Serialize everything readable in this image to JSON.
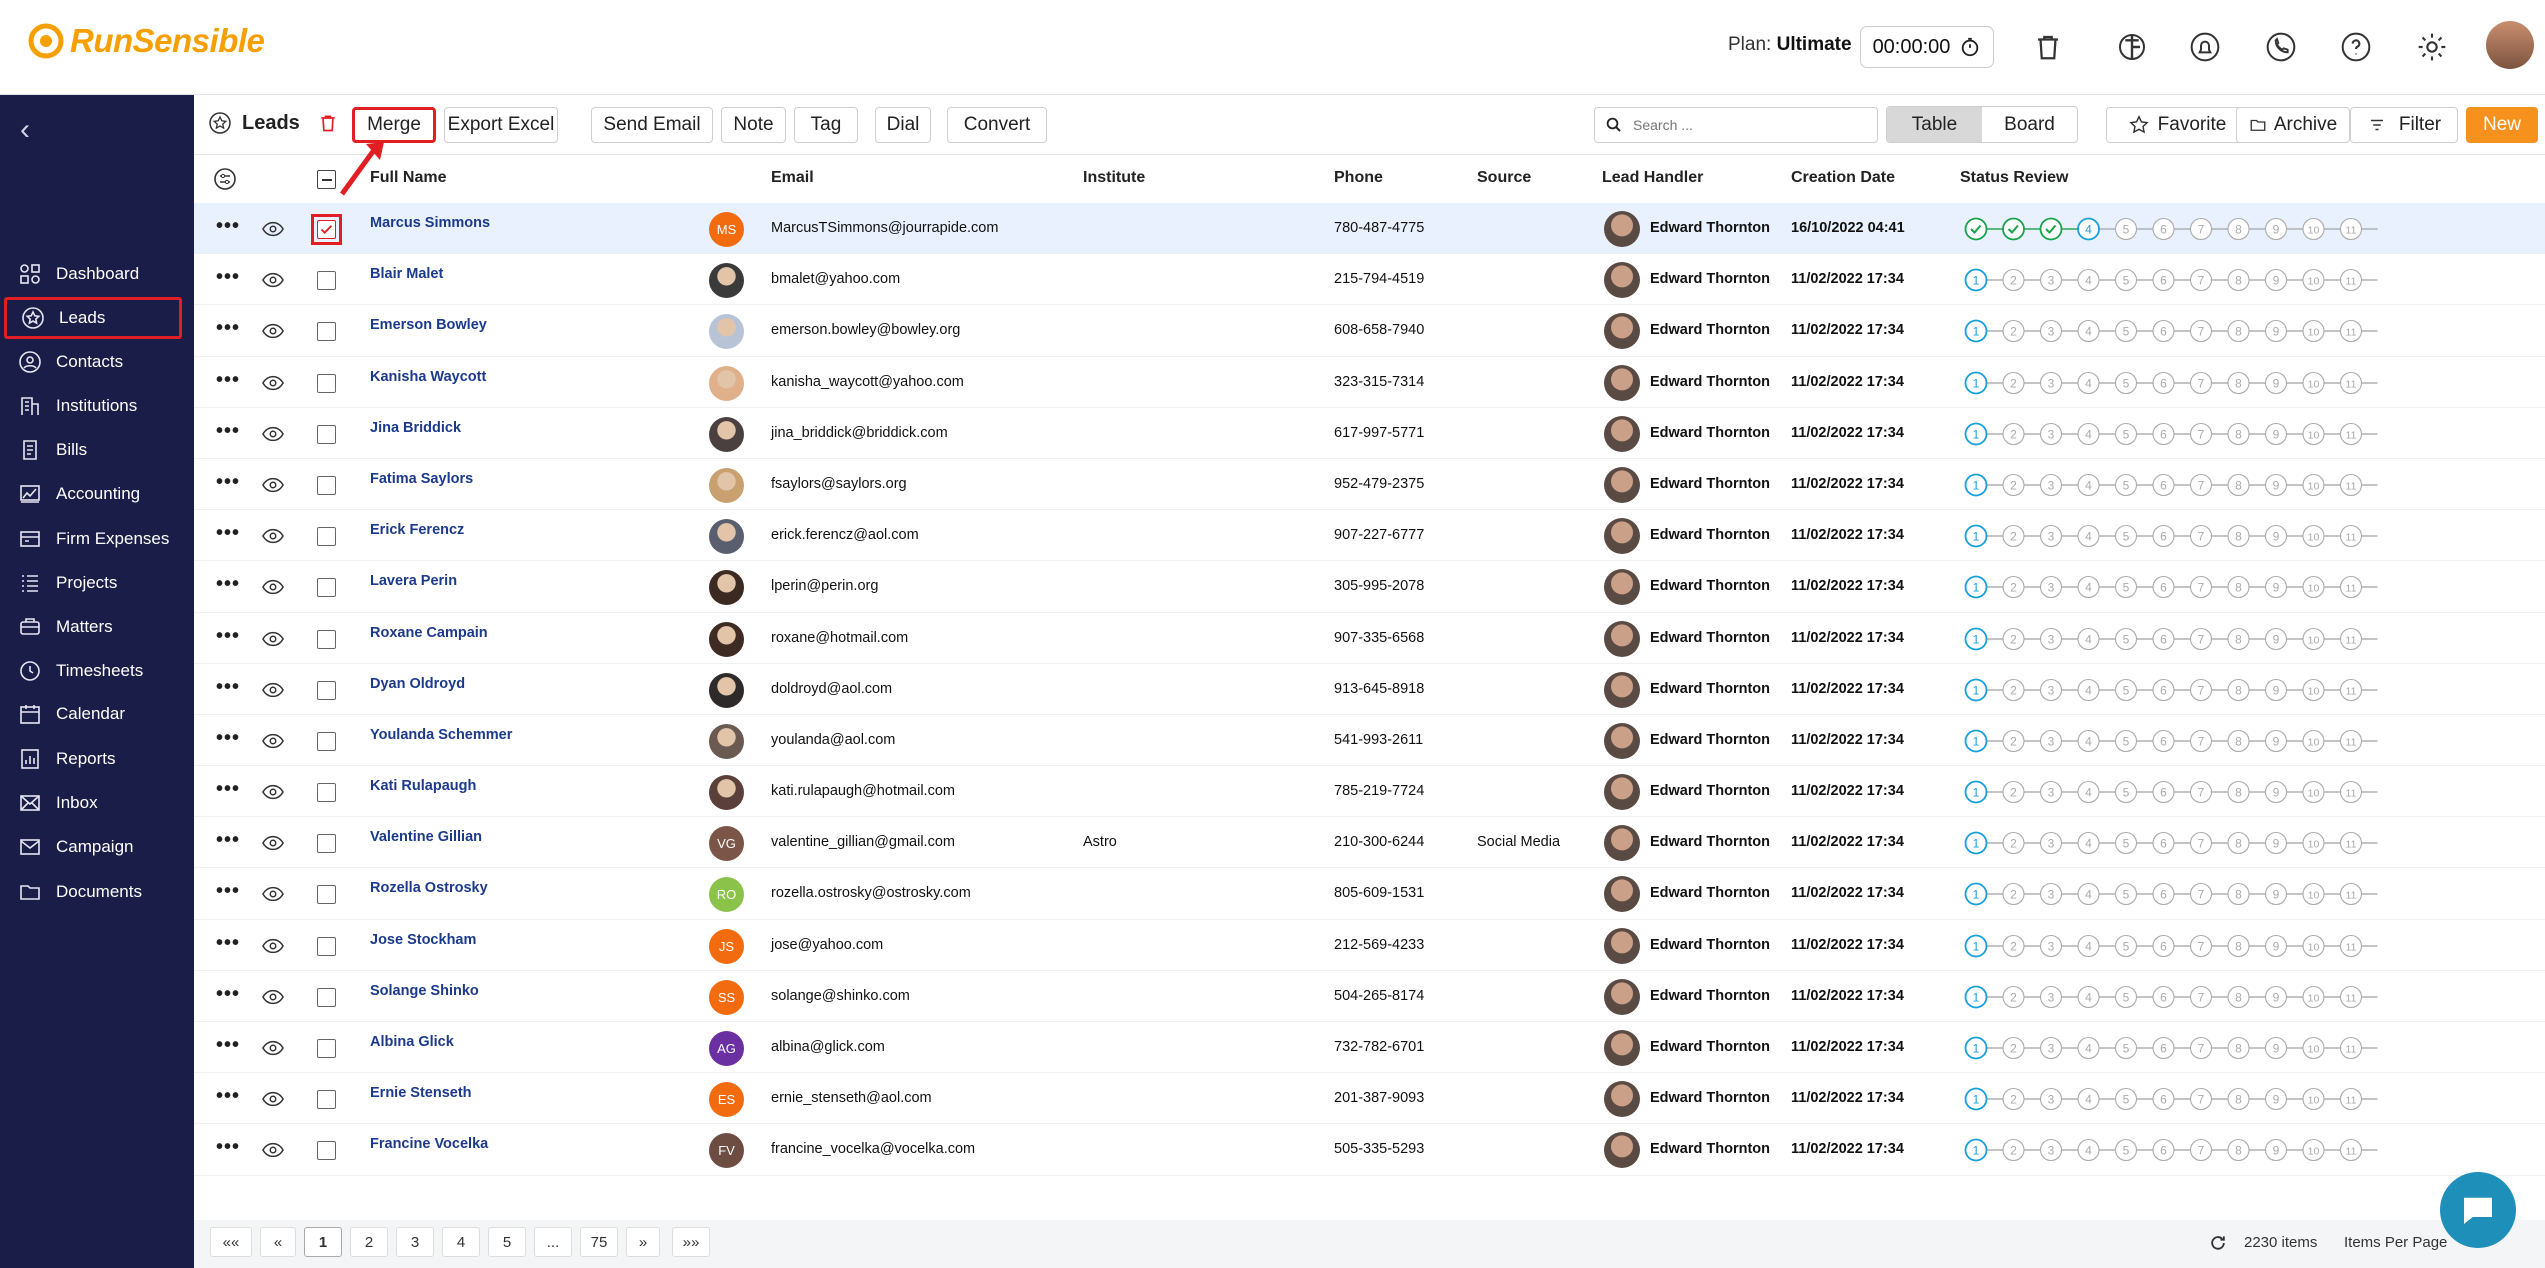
{
  "app": {
    "name": "RunSensible"
  },
  "header": {
    "plan_label": "Plan:",
    "plan_value": "Ultimate",
    "timer": "00:00:00"
  },
  "sidebar": {
    "items": [
      {
        "label": "Dashboard",
        "icon": "dashboard-icon"
      },
      {
        "label": "Leads",
        "icon": "leads-star-icon",
        "selected": true
      },
      {
        "label": "Contacts",
        "icon": "contacts-icon"
      },
      {
        "label": "Institutions",
        "icon": "institutions-icon"
      },
      {
        "label": "Bills",
        "icon": "bills-icon"
      },
      {
        "label": "Accounting",
        "icon": "accounting-icon"
      },
      {
        "label": "Firm Expenses",
        "icon": "firm-expenses-icon"
      },
      {
        "label": "Projects",
        "icon": "projects-icon"
      },
      {
        "label": "Matters",
        "icon": "matters-icon"
      },
      {
        "label": "Timesheets",
        "icon": "timesheets-icon"
      },
      {
        "label": "Calendar",
        "icon": "calendar-icon"
      },
      {
        "label": "Reports",
        "icon": "reports-icon"
      },
      {
        "label": "Inbox",
        "icon": "inbox-icon"
      },
      {
        "label": "Campaign",
        "icon": "campaign-icon"
      },
      {
        "label": "Documents",
        "icon": "documents-icon"
      }
    ]
  },
  "toolbar": {
    "title": "Leads",
    "actions": [
      "Merge",
      "Export Excel",
      "Send Email",
      "Note",
      "Tag",
      "Dial",
      "Convert"
    ],
    "search_placeholder": "Search ...",
    "views": [
      "Table",
      "Board"
    ],
    "active_view": "Table",
    "favorite": "Favorite",
    "archive": "Archive",
    "filter": "Filter",
    "new": "New"
  },
  "table": {
    "columns": {
      "full_name": "Full Name",
      "email": "Email",
      "institute": "Institute",
      "phone": "Phone",
      "source": "Source",
      "lead_handler": "Lead Handler",
      "creation_date": "Creation Date",
      "status_review": "Status Review"
    },
    "status_steps": [
      "1",
      "2",
      "3",
      "4",
      "5",
      "6",
      "7",
      "8",
      "9",
      "10",
      "11"
    ],
    "rows": [
      {
        "name": "Marcus Simmons",
        "initials": "MS",
        "avatar_color": "#f26b0f",
        "email": "MarcusTSimmons@jourrapide.com",
        "institute": "",
        "phone": "780-487-4775",
        "source": "",
        "handler": "Edward Thornton",
        "date": "16/10/2022 04:41",
        "checked": true,
        "status_done": 3
      },
      {
        "name": "Blair Malet",
        "initials": "",
        "avatar_color": "#3a3a3a",
        "email": "bmalet@yahoo.com",
        "institute": "",
        "phone": "215-794-4519",
        "source": "",
        "handler": "Edward Thornton",
        "date": "11/02/2022 17:34",
        "checked": false,
        "status_done": 0
      },
      {
        "name": "Emerson Bowley",
        "initials": "",
        "avatar_color": "#b8c4d6",
        "email": "emerson.bowley@bowley.org",
        "institute": "",
        "phone": "608-658-7940",
        "source": "",
        "handler": "Edward Thornton",
        "date": "11/02/2022 17:34",
        "checked": false,
        "status_done": 0
      },
      {
        "name": "Kanisha Waycott",
        "initials": "",
        "avatar_color": "#e0b08a",
        "email": "kanisha_waycott@yahoo.com",
        "institute": "",
        "phone": "323-315-7314",
        "source": "",
        "handler": "Edward Thornton",
        "date": "11/02/2022 17:34",
        "checked": false,
        "status_done": 0
      },
      {
        "name": "Jina Briddick",
        "initials": "",
        "avatar_color": "#4a4040",
        "email": "jina_briddick@briddick.com",
        "institute": "",
        "phone": "617-997-5771",
        "source": "",
        "handler": "Edward Thornton",
        "date": "11/02/2022 17:34",
        "checked": false,
        "status_done": 0
      },
      {
        "name": "Fatima Saylors",
        "initials": "",
        "avatar_color": "#c9a070",
        "email": "fsaylors@saylors.org",
        "institute": "",
        "phone": "952-479-2375",
        "source": "",
        "handler": "Edward Thornton",
        "date": "11/02/2022 17:34",
        "checked": false,
        "status_done": 0
      },
      {
        "name": "Erick Ferencz",
        "initials": "",
        "avatar_color": "#5a5f70",
        "email": "erick.ferencz@aol.com",
        "institute": "",
        "phone": "907-227-6777",
        "source": "",
        "handler": "Edward Thornton",
        "date": "11/02/2022 17:34",
        "checked": false,
        "status_done": 0
      },
      {
        "name": "Lavera Perin",
        "initials": "",
        "avatar_color": "#3b2a22",
        "email": "lperin@perin.org",
        "institute": "",
        "phone": "305-995-2078",
        "source": "",
        "handler": "Edward Thornton",
        "date": "11/02/2022 17:34",
        "checked": false,
        "status_done": 0
      },
      {
        "name": "Roxane Campain",
        "initials": "",
        "avatar_color": "#3e2b24",
        "email": "roxane@hotmail.com",
        "institute": "",
        "phone": "907-335-6568",
        "source": "",
        "handler": "Edward Thornton",
        "date": "11/02/2022 17:34",
        "checked": false,
        "status_done": 0
      },
      {
        "name": "Dyan Oldroyd",
        "initials": "",
        "avatar_color": "#2f2a2a",
        "email": "doldroyd@aol.com",
        "institute": "",
        "phone": "913-645-8918",
        "source": "",
        "handler": "Edward Thornton",
        "date": "11/02/2022 17:34",
        "checked": false,
        "status_done": 0
      },
      {
        "name": "Youlanda Schemmer",
        "initials": "",
        "avatar_color": "#6a5a52",
        "email": "youlanda@aol.com",
        "institute": "",
        "phone": "541-993-2611",
        "source": "",
        "handler": "Edward Thornton",
        "date": "11/02/2022 17:34",
        "checked": false,
        "status_done": 0
      },
      {
        "name": "Kati Rulapaugh",
        "initials": "",
        "avatar_color": "#5a3f3a",
        "email": "kati.rulapaugh@hotmail.com",
        "institute": "",
        "phone": "785-219-7724",
        "source": "",
        "handler": "Edward Thornton",
        "date": "11/02/2022 17:34",
        "checked": false,
        "status_done": 0
      },
      {
        "name": "Valentine Gillian",
        "initials": "VG",
        "avatar_color": "#7a5548",
        "email": "valentine_gillian@gmail.com",
        "institute": "Astro",
        "phone": "210-300-6244",
        "source": "Social Media",
        "handler": "Edward Thornton",
        "date": "11/02/2022 17:34",
        "checked": false,
        "status_done": 0
      },
      {
        "name": "Rozella Ostrosky",
        "initials": "RO",
        "avatar_color": "#8bc34a",
        "email": "rozella.ostrosky@ostrosky.com",
        "institute": "",
        "phone": "805-609-1531",
        "source": "",
        "handler": "Edward Thornton",
        "date": "11/02/2022 17:34",
        "checked": false,
        "status_done": 0
      },
      {
        "name": "Jose Stockham",
        "initials": "JS",
        "avatar_color": "#f26b0f",
        "email": "jose@yahoo.com",
        "institute": "",
        "phone": "212-569-4233",
        "source": "",
        "handler": "Edward Thornton",
        "date": "11/02/2022 17:34",
        "checked": false,
        "status_done": 0
      },
      {
        "name": "Solange Shinko",
        "initials": "SS",
        "avatar_color": "#f26b0f",
        "email": "solange@shinko.com",
        "institute": "",
        "phone": "504-265-8174",
        "source": "",
        "handler": "Edward Thornton",
        "date": "11/02/2022 17:34",
        "checked": false,
        "status_done": 0
      },
      {
        "name": "Albina Glick",
        "initials": "AG",
        "avatar_color": "#6a2fa0",
        "email": "albina@glick.com",
        "institute": "",
        "phone": "732-782-6701",
        "source": "",
        "handler": "Edward Thornton",
        "date": "11/02/2022 17:34",
        "checked": false,
        "status_done": 0
      },
      {
        "name": "Ernie Stenseth",
        "initials": "ES",
        "avatar_color": "#f26b0f",
        "email": "ernie_stenseth@aol.com",
        "institute": "",
        "phone": "201-387-9093",
        "source": "",
        "handler": "Edward Thornton",
        "date": "11/02/2022 17:34",
        "checked": false,
        "status_done": 0
      },
      {
        "name": "Francine Vocelka",
        "initials": "FV",
        "avatar_color": "#6d4c41",
        "email": "francine_vocelka@vocelka.com",
        "institute": "",
        "phone": "505-335-5293",
        "source": "",
        "handler": "Edward Thornton",
        "date": "11/02/2022 17:34",
        "checked": false,
        "status_done": 0
      }
    ]
  },
  "pagination": {
    "first": "«« ",
    "prev": "«",
    "pages": [
      "1",
      "2",
      "3",
      "4",
      "5",
      "...",
      "75"
    ],
    "current": "1",
    "next": "»",
    "last": "»»",
    "items_count": "2230 items",
    "items_per_page": "Items Per Page"
  },
  "colors": {
    "sidebar_bg": "#1a1d47",
    "accent": "#f7911e",
    "highlight": "#e01e24",
    "step_active": "#1aa0d8",
    "step_done": "#17a34a"
  }
}
